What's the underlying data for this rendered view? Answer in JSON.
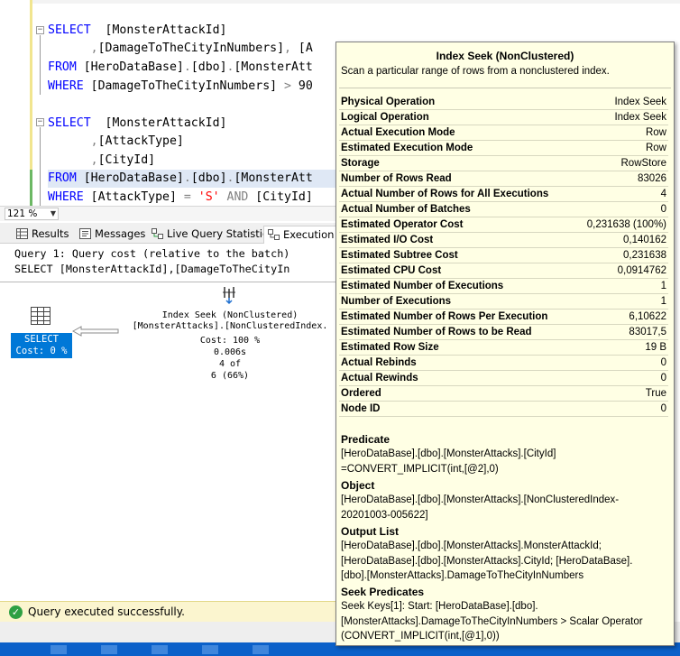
{
  "editor": {
    "lines": [
      {
        "fold": "-",
        "parts": [
          {
            "c": "kw",
            "t": "SELECT"
          },
          {
            "c": "tx",
            "t": "  [MonsterAttackId]"
          }
        ]
      },
      {
        "fold": "",
        "parts": [
          {
            "c": "gr",
            "t": "      ,"
          },
          {
            "c": "tx",
            "t": "[DamageToTheCityInNumbers]"
          },
          {
            "c": "gr",
            "t": ", "
          },
          {
            "c": "tx",
            "t": "[A"
          }
        ]
      },
      {
        "fold": "",
        "parts": [
          {
            "c": "kw",
            "t": "FROM "
          },
          {
            "c": "tx",
            "t": "[HeroDataBase]"
          },
          {
            "c": "gr",
            "t": "."
          },
          {
            "c": "tx",
            "t": "[dbo]"
          },
          {
            "c": "gr",
            "t": "."
          },
          {
            "c": "tx",
            "t": "[MonsterAtt"
          }
        ]
      },
      {
        "fold": "",
        "parts": [
          {
            "c": "kw",
            "t": "WHERE "
          },
          {
            "c": "tx",
            "t": "[DamageToTheCityInNumbers] "
          },
          {
            "c": "gr",
            "t": "> "
          },
          {
            "c": "tx",
            "t": "90"
          }
        ]
      },
      {
        "fold": "",
        "parts": []
      },
      {
        "fold": "-",
        "parts": [
          {
            "c": "kw",
            "t": "SELECT"
          },
          {
            "c": "tx",
            "t": "  [MonsterAttackId]"
          }
        ]
      },
      {
        "fold": "",
        "parts": [
          {
            "c": "gr",
            "t": "      ,"
          },
          {
            "c": "tx",
            "t": "[AttackType]"
          }
        ]
      },
      {
        "fold": "",
        "parts": [
          {
            "c": "gr",
            "t": "      ,"
          },
          {
            "c": "tx",
            "t": "[CityId]"
          }
        ]
      },
      {
        "fold": "",
        "parts": [
          {
            "c": "kw",
            "t": "FROM "
          },
          {
            "c": "tx",
            "t": "[HeroDataBase]"
          },
          {
            "c": "gr",
            "t": "."
          },
          {
            "c": "tx",
            "t": "[dbo]"
          },
          {
            "c": "gr",
            "t": "."
          },
          {
            "c": "tx",
            "t": "[MonsterAtt"
          }
        ]
      },
      {
        "fold": "",
        "parts": [
          {
            "c": "kw",
            "t": "WHERE "
          },
          {
            "c": "tx",
            "t": "[AttackType] "
          },
          {
            "c": "gr",
            "t": "= "
          },
          {
            "c": "rd",
            "t": "'S' "
          },
          {
            "c": "gr",
            "t": "AND "
          },
          {
            "c": "tx",
            "t": "[CityId]"
          }
        ]
      }
    ]
  },
  "zoom": {
    "value": "121 %"
  },
  "tabs": [
    {
      "label": "Results",
      "icon": "grid-icon"
    },
    {
      "label": "Messages",
      "icon": "messages-icon"
    },
    {
      "label": "Live Query Statistics",
      "icon": "live-stats-icon"
    },
    {
      "label": "Execution p",
      "icon": "execution-plan-icon"
    }
  ],
  "results": {
    "query_header": "Query 1: Query cost (relative to the batch)",
    "query_text": "SELECT [MonsterAttackId],[DamageToTheCityIn",
    "select_node": {
      "line1": "SELECT",
      "line2": "Cost: 0 %"
    },
    "seek_node": {
      "line1": "Index Seek (NonClustered)",
      "line2": "[MonsterAttacks].[NonClusteredIndex.",
      "cost": "Cost: 100 %",
      "time": "0.006s",
      "rows": "4 of",
      "estimate": "6 (66%)"
    }
  },
  "status": {
    "text": "Query executed successfully.",
    "icon": "check-icon"
  },
  "tooltip": {
    "title": "Index Seek (NonClustered)",
    "description": "Scan a particular range of rows from a nonclustered index.",
    "properties": [
      {
        "name": "Physical Operation",
        "value": "Index Seek"
      },
      {
        "name": "Logical Operation",
        "value": "Index Seek"
      },
      {
        "name": "Actual Execution Mode",
        "value": "Row"
      },
      {
        "name": "Estimated Execution Mode",
        "value": "Row"
      },
      {
        "name": "Storage",
        "value": "RowStore"
      },
      {
        "name": "Number of Rows Read",
        "value": "83026"
      },
      {
        "name": "Actual Number of Rows for All Executions",
        "value": "4"
      },
      {
        "name": "Actual Number of Batches",
        "value": "0"
      },
      {
        "name": "Estimated Operator Cost",
        "value": "0,231638 (100%)"
      },
      {
        "name": "Estimated I/O Cost",
        "value": "0,140162"
      },
      {
        "name": "Estimated Subtree Cost",
        "value": "0,231638"
      },
      {
        "name": "Estimated CPU Cost",
        "value": "0,0914762"
      },
      {
        "name": "Estimated Number of Executions",
        "value": "1"
      },
      {
        "name": "Number of Executions",
        "value": "1"
      },
      {
        "name": "Estimated Number of Rows Per Execution",
        "value": "6,10622"
      },
      {
        "name": "Estimated Number of Rows to be Read",
        "value": "83017,5"
      },
      {
        "name": "Estimated Row Size",
        "value": "19 B"
      },
      {
        "name": "Actual Rebinds",
        "value": "0"
      },
      {
        "name": "Actual Rewinds",
        "value": "0"
      },
      {
        "name": "Ordered",
        "value": "True"
      },
      {
        "name": "Node ID",
        "value": "0"
      }
    ],
    "sections": {
      "predicate": {
        "heading": "Predicate",
        "body": "[HeroDataBase].[dbo].[MonsterAttacks].[CityId]\n=CONVERT_IMPLICIT(int,[@2],0)"
      },
      "object": {
        "heading": "Object",
        "body": "[HeroDataBase].[dbo].[MonsterAttacks].[NonClusteredIndex-\n20201003-005622]"
      },
      "output_list": {
        "heading": "Output List",
        "body": "[HeroDataBase].[dbo].[MonsterAttacks].MonsterAttackId;\n[HeroDataBase].[dbo].[MonsterAttacks].CityId; [HeroDataBase].\n[dbo].[MonsterAttacks].DamageToTheCityInNumbers"
      },
      "seek_predicates": {
        "heading": "Seek Predicates",
        "body": "Seek Keys[1]: Start: [HeroDataBase].[dbo].\n[MonsterAttacks].DamageToTheCityInNumbers > Scalar Operator\n(CONVERT_IMPLICIT(int,[@1],0))"
      }
    }
  },
  "colors": {
    "accent": "#0078d7",
    "tooltip_bg": "#ffffe4",
    "status_bg": "#fbf5cf",
    "keyword": "#0000ff",
    "string": "#ff0000"
  }
}
